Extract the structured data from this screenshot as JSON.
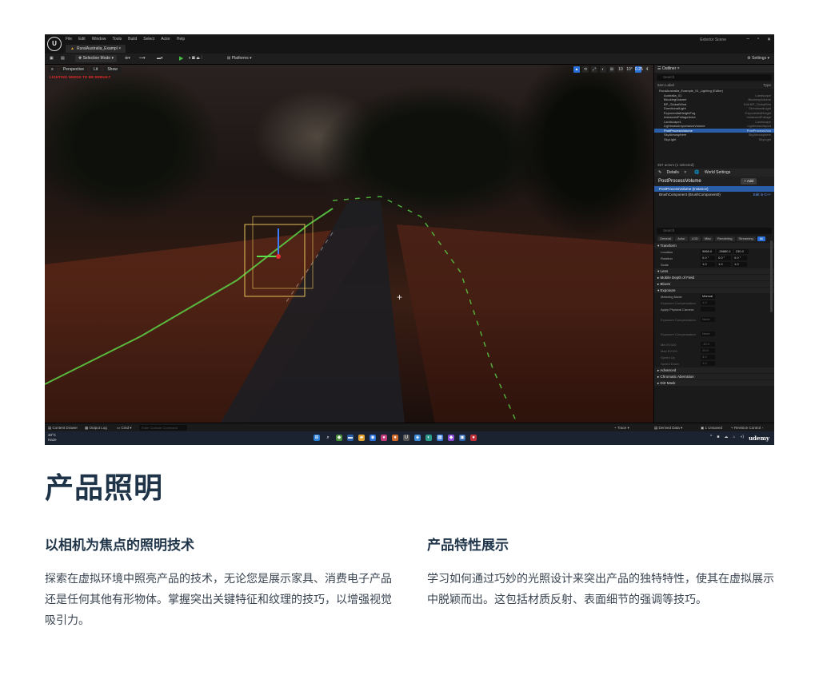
{
  "editor": {
    "menu": [
      "File",
      "Edit",
      "Window",
      "Tools",
      "Build",
      "Select",
      "Actor",
      "Help"
    ],
    "project_tab": "RuralAustralia_Exampl",
    "scene_name": "Exterior Scene",
    "toolbar": {
      "selection_mode": "Selection Mode",
      "platforms": "Platforms",
      "settings": "Settings"
    },
    "viewport": {
      "perspective": "Perspective",
      "lit": "Lit",
      "show": "Show",
      "warning": "LIGHTING NEEDS TO BE REBUILT",
      "right_tools": [
        "▲",
        "⟲",
        "⤢",
        "◐",
        "⊞",
        "10",
        "10°",
        "0.25",
        "4"
      ]
    },
    "outliner": {
      "tab": "Outliner",
      "search_placeholder": "Search",
      "col_label": "Item Label",
      "col_type": "Type",
      "rows": [
        {
          "label": "RuralAustralia_Example_01_Lighting (Editor)",
          "type": ""
        },
        {
          "label": "Australia_01",
          "type": "Landscape"
        },
        {
          "label": "BlockingVolume",
          "type": "BlockingVolume"
        },
        {
          "label": "BP_GlobalWind",
          "type": "Edit BP_GlobalWin"
        },
        {
          "label": "DirectionalLight",
          "type": "DirectionalLight"
        },
        {
          "label": "ExponentialHeightFog",
          "type": "ExponentialHeight"
        },
        {
          "label": "InstancedFoliageActor",
          "type": "InstancedFoliage"
        },
        {
          "label": "Landscape1",
          "type": "Landscape"
        },
        {
          "label": "LightmassImportanceVolume",
          "type": "LightmassImport"
        },
        {
          "label": "PostProcessVolume",
          "type": "PostProcessVolu",
          "selected": true
        },
        {
          "label": "SkyAtmosphere",
          "type": "SkyAtmosphere"
        },
        {
          "label": "SkyLight",
          "type": "SkyLight"
        }
      ],
      "footer": "357 actors (1 selected)"
    },
    "details": {
      "tab_details": "Details",
      "tab_world": "World Settings",
      "title": "PostProcessVolume",
      "add": "+ Add",
      "components": [
        {
          "label": "PostProcessVolume (Instance)",
          "selected": true,
          "link": ""
        },
        {
          "label": "BrushComponent (BrushComponent0)",
          "selected": false,
          "link": "Edit in C++"
        }
      ],
      "search_placeholder": "Search",
      "filters": [
        "General",
        "Actor",
        "LOD",
        "Misc",
        "Rendering",
        "Streaming",
        "All"
      ],
      "active_filter": "All",
      "transform_head": "Transform",
      "transform": [
        {
          "name": "Location",
          "values": [
            "9865.0",
            "-28880.1",
            "230.0"
          ]
        },
        {
          "name": "Rotation",
          "values": [
            "0.0 °",
            "0.0 °",
            "0.0 °"
          ]
        },
        {
          "name": "Scale",
          "values": [
            "1.0",
            "1.0",
            "1.0"
          ]
        }
      ],
      "sections": [
        "Lens",
        "Mobile Depth of Field",
        "Bloom",
        "Exposure"
      ],
      "exposure_props": [
        {
          "name": "Metering Mode",
          "value": "Manual",
          "dim": false
        },
        {
          "name": "Exposure Compensation",
          "value": "1.0",
          "dim": true
        },
        {
          "name": "Apply Physical Camera",
          "value": "",
          "dim": false
        },
        {
          "name": "Exposure Compensation",
          "value": "None",
          "dim": true,
          "tall": true
        },
        {
          "name": "Exposure Compensation",
          "value": "None",
          "dim": true,
          "tall": true
        },
        {
          "name": "Min EV100",
          "value": "-10.0",
          "dim": true
        },
        {
          "name": "Max EV100",
          "value": "20.0",
          "dim": true
        },
        {
          "name": "Speed Up",
          "value": "3.0",
          "dim": true
        },
        {
          "name": "Speed Down",
          "value": "1.0",
          "dim": true
        }
      ],
      "more_sections": [
        "Advanced",
        "Chromatic Aberration",
        "Dirt Mask"
      ]
    },
    "statusbar": {
      "content_drawer": "Content Drawer",
      "output_log": "Output Log",
      "cmd": "Cmd",
      "cmd_placeholder": "Enter Console Command",
      "trace": "Trace",
      "derived_data": "Derived Data",
      "unsaved": "1 Unsaved",
      "revision": "Revision Control"
    },
    "taskbar": {
      "temp": "33°C",
      "weather": "Haze",
      "udemy": "udemy"
    }
  },
  "page": {
    "title": "产品照明",
    "columns": [
      {
        "heading": "以相机为焦点的照明技术",
        "body": "探索在虚拟环境中照亮产品的技术，无论您是展示家具、消费电子产品还是任何其他有形物体。掌握突出关键特征和纹理的技巧，以增强视觉吸引力。"
      },
      {
        "heading": "产品特性展示",
        "body": "学习如何通过巧妙的光照设计来突出产品的独特特性，使其在虚拟展示中脱颖而出。这包括材质反射、表面细节的强调等技巧。"
      }
    ]
  }
}
